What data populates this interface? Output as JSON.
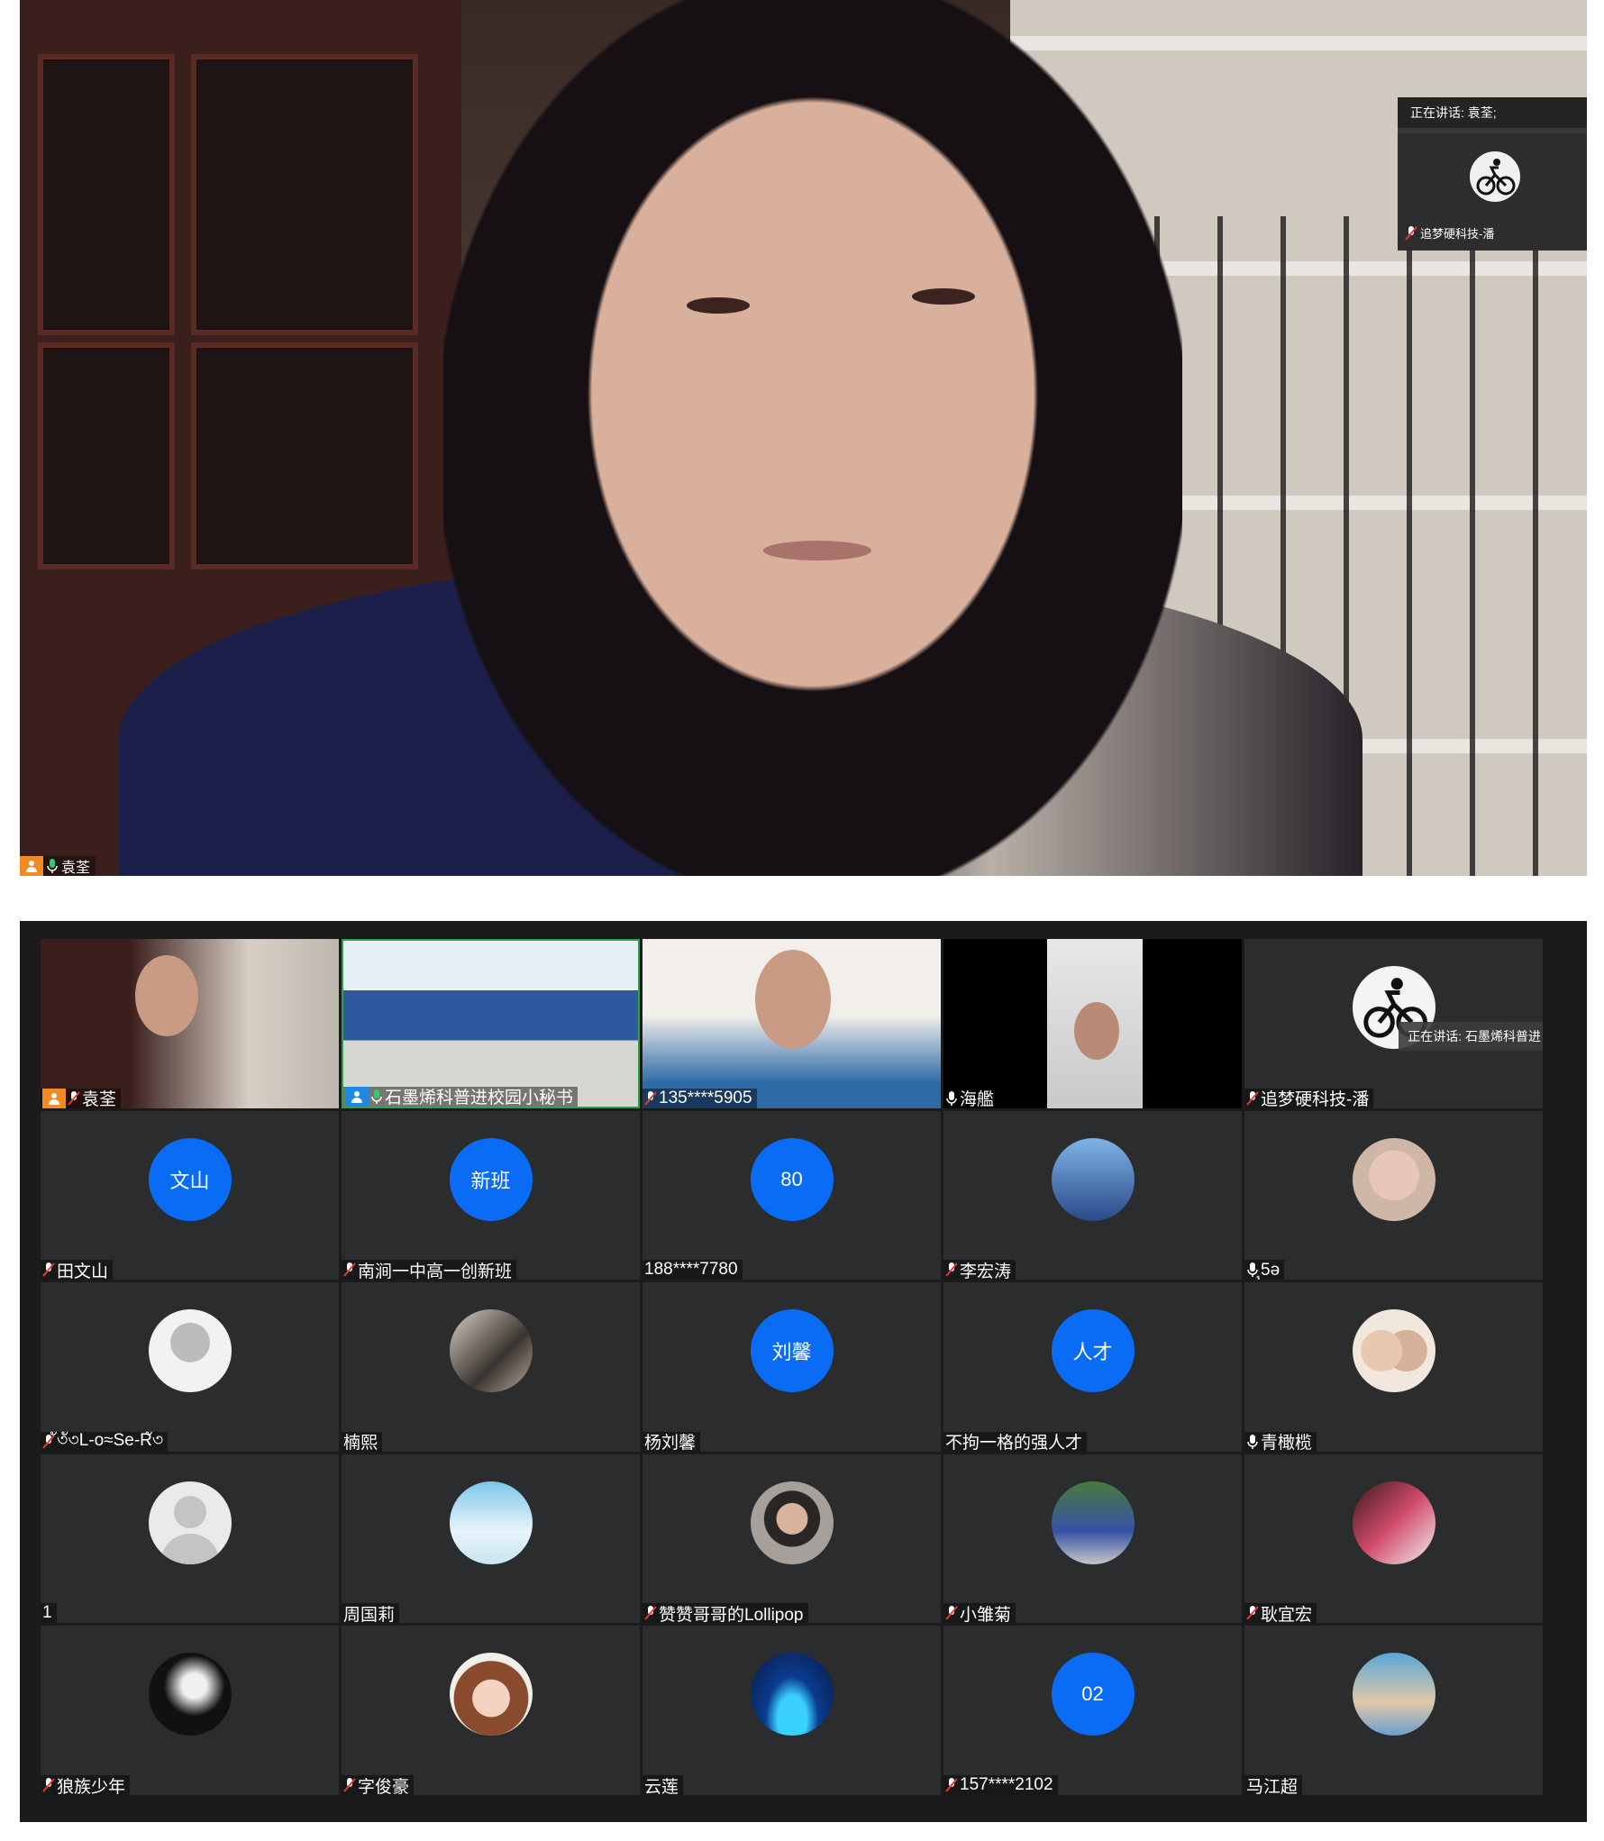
{
  "speaker_view": {
    "speaker_name": "袁荃",
    "active_speaker_prefix": "正在讲话:",
    "active_speaker_name": "袁荃;",
    "pip_participant": "追梦硬科技-潘"
  },
  "gallery": {
    "active_speaker_text": "正在讲话: 石墨烯科普进",
    "tiles": [
      {
        "name": "袁荃",
        "type": "video",
        "host": true,
        "mic": "muted"
      },
      {
        "name": "石墨烯科普进校园小秘书",
        "type": "video",
        "host": true,
        "mic": "on"
      },
      {
        "name": "135****5905",
        "type": "video",
        "mic": "muted"
      },
      {
        "name": "海艦",
        "type": "video",
        "mic": "on"
      },
      {
        "name": "追梦硬科技-潘",
        "type": "avatar",
        "mic": "muted"
      },
      {
        "name": "田文山",
        "avatar_text": "文山",
        "mic": "muted"
      },
      {
        "name": "南涧一中高一创新班",
        "avatar_text": "新班",
        "mic": "muted"
      },
      {
        "name": "188****7780",
        "avatar_text": "80",
        "mic": "none"
      },
      {
        "name": "李宏涛",
        "mic": "muted"
      },
      {
        "name": "ุ5ә",
        "mic": "on"
      },
      {
        "name": "ั৩ั৩L-o≈Se-Rั৩",
        "mic": "muted"
      },
      {
        "name": "楠熙",
        "mic": "none"
      },
      {
        "name": "杨刘馨",
        "avatar_text": "刘馨",
        "mic": "none"
      },
      {
        "name": "不拘一格的强人才",
        "avatar_text": "人才",
        "mic": "none"
      },
      {
        "name": "青橄榄",
        "mic": "on"
      },
      {
        "name": "1",
        "mic": "none"
      },
      {
        "name": "周国莉",
        "mic": "none"
      },
      {
        "name": "赞赞哥哥的Lollipop",
        "mic": "muted"
      },
      {
        "name": "小雏菊",
        "mic": "muted"
      },
      {
        "name": "耿宜宏",
        "mic": "muted"
      },
      {
        "name": "狼族少年",
        "mic": "muted"
      },
      {
        "name": "字俊豪",
        "mic": "muted"
      },
      {
        "name": "云莲",
        "mic": "none"
      },
      {
        "name": "157****2102",
        "avatar_text": "02",
        "mic": "muted"
      },
      {
        "name": "马江超",
        "mic": "none"
      }
    ]
  },
  "colors": {
    "avatar_blue": "#0a6cf5",
    "host_orange": "#f08a24",
    "tile_bg": "#2b2c2e",
    "gallery_bg": "#1b1b1c"
  }
}
